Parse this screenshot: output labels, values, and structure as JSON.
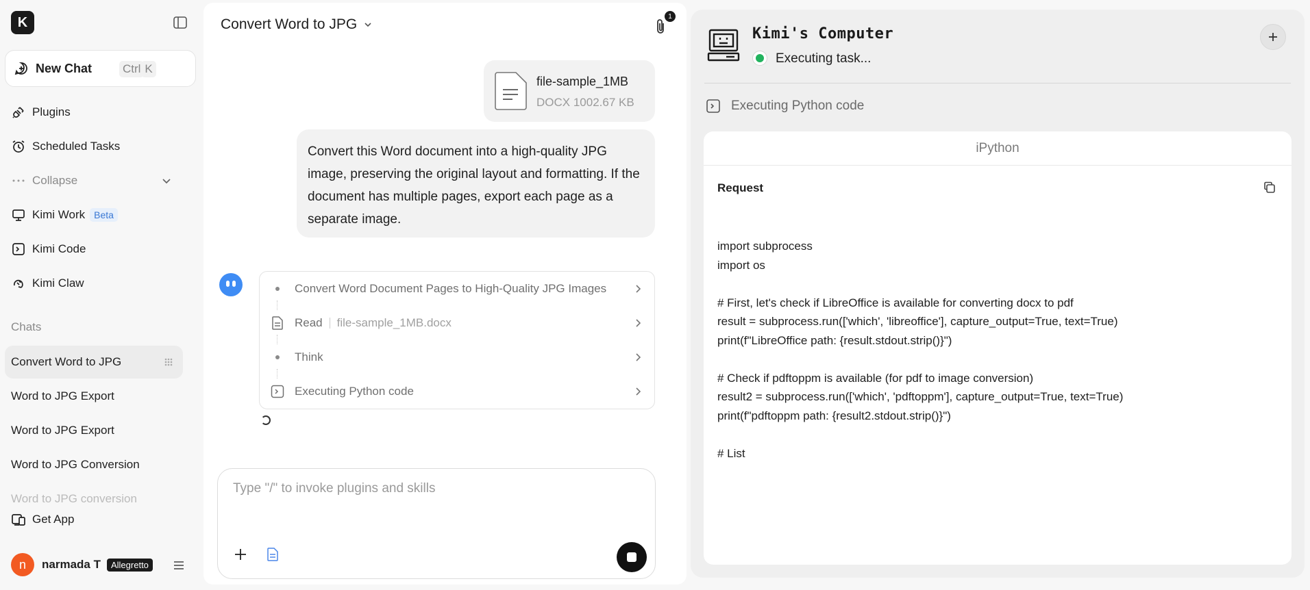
{
  "sidebar": {
    "logo": "K",
    "new_chat": {
      "label": "New Chat",
      "shortcut_ctrl": "Ctrl",
      "shortcut_key": "K"
    },
    "nav": {
      "plugins": "Plugins",
      "scheduled": "Scheduled Tasks",
      "collapse": "Collapse",
      "kimi_work": "Kimi Work",
      "kimi_work_badge": "Beta",
      "kimi_code": "Kimi Code",
      "kimi_claw": "Kimi Claw"
    },
    "chats_label": "Chats",
    "chats": [
      "Convert Word to JPG",
      "Word to JPG Export",
      "Word to JPG Export",
      "Word to JPG Conversion",
      "Word to JPG conversion"
    ],
    "get_app": "Get App",
    "user": {
      "initial": "n",
      "name": "narmada T",
      "plan": "Allegretto"
    }
  },
  "chat": {
    "title": "Convert Word to JPG",
    "attachment_count": "1",
    "file": {
      "name": "file-sample_1MB",
      "meta": "DOCX 1002.67 KB"
    },
    "user_message": "Convert this Word document into a high-quality JPG image, preserving the original layout and formatting. If the document has multiple pages, export each page as a separate image.",
    "steps": {
      "s1": "Convert Word Document Pages to High-Quality JPG Images",
      "s2": "Read",
      "s2_meta": "file-sample_1MB.docx",
      "s3": "Think",
      "s4": "Executing Python code"
    },
    "input_placeholder": "Type \"/\" to invoke plugins and skills"
  },
  "computer": {
    "title": "Kimi's Computer",
    "status": "Executing task...",
    "status_color": "#22b35e",
    "action": "Executing Python code",
    "panel_title": "iPython",
    "request_label": "Request",
    "code": "import subprocess\nimport os\n\n# First, let's check if LibreOffice is available for converting docx to pdf\nresult = subprocess.run(['which', 'libreoffice'], capture_output=True, text=True)\nprint(f\"LibreOffice path: {result.stdout.strip()}\")\n\n# Check if pdftoppm is available (for pdf to image conversion)\nresult2 = subprocess.run(['which', 'pdftoppm'], capture_output=True, text=True)\nprint(f\"pdftoppm path: {result2.stdout.strip()}\")\n\n# List"
  }
}
